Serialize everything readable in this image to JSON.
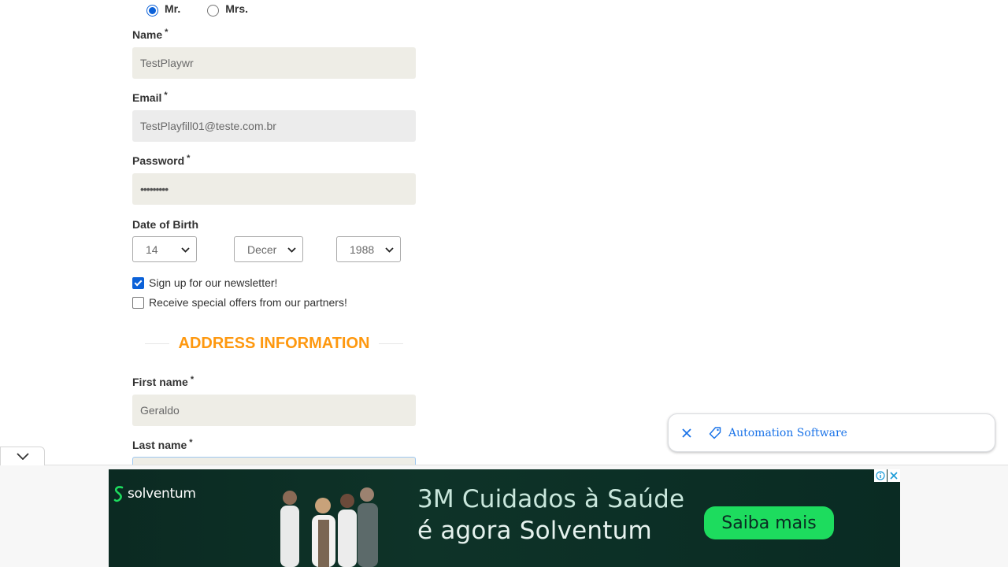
{
  "form": {
    "title_options": [
      {
        "label": "Mr.",
        "checked": true
      },
      {
        "label": "Mrs.",
        "checked": false
      }
    ],
    "name_label": "Name",
    "name_value": "TestPlaywr",
    "email_label": "Email",
    "email_value": "TestPlayfill01@teste.com.br",
    "password_label": "Password",
    "password_value": "•••••••••",
    "required_mark": "*",
    "dob_label": "Date of Birth",
    "dob_day": "14",
    "dob_month": "Decer",
    "dob_year": "1988",
    "newsletter_label": "Sign up for our newsletter!",
    "newsletter_checked": true,
    "offers_label": "Receive special offers from our partners!",
    "offers_checked": false,
    "address_section_title": "ADDRESS INFORMATION",
    "first_name_label": "First name",
    "first_name_value": "Geraldo",
    "last_name_label": "Last name"
  },
  "chip_popup": {
    "text": "Automation Software",
    "close_icon": "close-icon",
    "tag_icon": "tag-icon"
  },
  "ad": {
    "brand": "solventum",
    "headline_line1": "3M Cuidados à Saúde",
    "headline_line2": "é agora Solventum",
    "cta": "Saiba mais",
    "brand_color": "#1ddc5e",
    "bg_color": "#0b2a22"
  },
  "colors": {
    "accent_orange": "#fe980f",
    "link_blue": "#1a73e8",
    "check_blue": "#0b61d8"
  }
}
